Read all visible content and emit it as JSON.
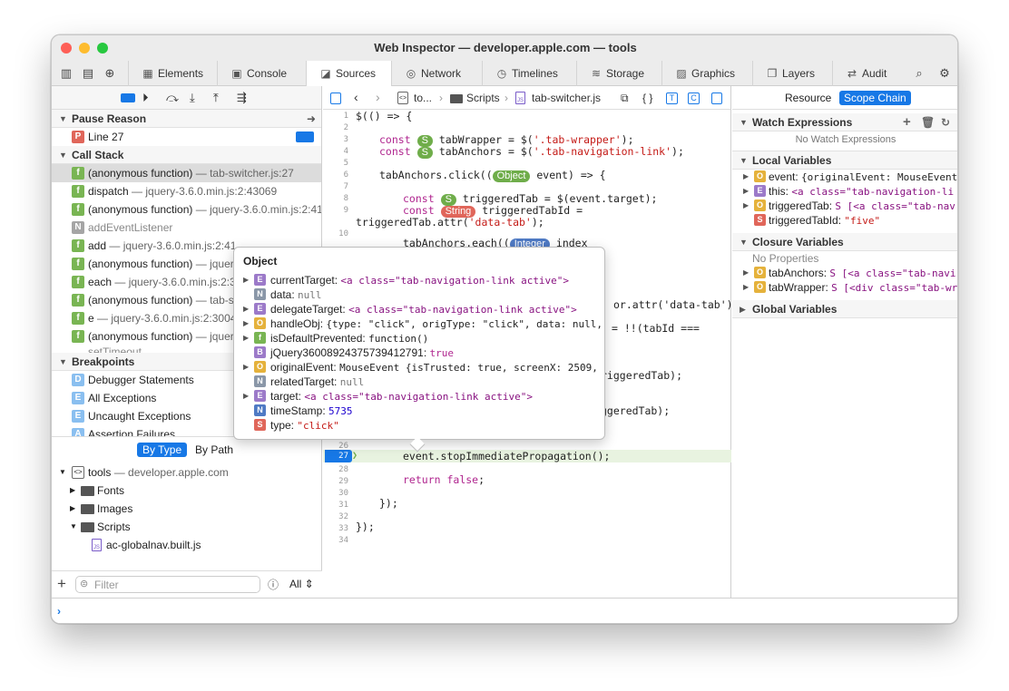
{
  "window": {
    "title": "Web Inspector — developer.apple.com — tools"
  },
  "tabs": [
    {
      "label": "Elements",
      "icon": "elements-icon"
    },
    {
      "label": "Console",
      "icon": "console-icon"
    },
    {
      "label": "Sources",
      "icon": "sources-icon"
    },
    {
      "label": "Network",
      "icon": "network-icon"
    },
    {
      "label": "Timelines",
      "icon": "timelines-icon"
    },
    {
      "label": "Storage",
      "icon": "storage-icon"
    },
    {
      "label": "Graphics",
      "icon": "graphics-icon"
    },
    {
      "label": "Layers",
      "icon": "layers-icon"
    },
    {
      "label": "Audit",
      "icon": "audit-icon"
    }
  ],
  "left": {
    "pause_reason_header": "Pause Reason",
    "pause_line": "Line 27",
    "call_stack_header": "Call Stack",
    "call_stack": [
      {
        "name": "(anonymous function)",
        "loc": "tab-switcher.js:27"
      },
      {
        "name": "dispatch",
        "loc": "jquery-3.6.0.min.js:2:43069"
      },
      {
        "name": "(anonymous function)",
        "loc": "jquery-3.6.0.min.js:2:41"
      },
      {
        "name": "addEventListener",
        "loc": ""
      },
      {
        "name": "add",
        "loc": "jquery-3.6.0.min.js:2:41"
      },
      {
        "name": "(anonymous function)",
        "loc": "jquery"
      },
      {
        "name": "each",
        "loc": "jquery-3.6.0.min.js:2:3"
      },
      {
        "name": "(anonymous function)",
        "loc": "tab-s"
      },
      {
        "name": "e",
        "loc": "jquery-3.6.0.min.js:2:3004"
      },
      {
        "name": "(anonymous function)",
        "loc": "jquery"
      },
      {
        "name": "setTimeout",
        "loc": ""
      }
    ],
    "breakpoints_header": "Breakpoints",
    "breakpoints": [
      "Debugger Statements",
      "All Exceptions",
      "Uncaught Exceptions",
      "Assertion Failures"
    ],
    "by_type": "By Type",
    "by_path": "By Path",
    "tree": [
      {
        "label": "tools",
        "sub": "developer.apple.com"
      },
      {
        "label": "Fonts"
      },
      {
        "label": "Images"
      },
      {
        "label": "Scripts"
      },
      {
        "label": "ac-globalnav.built.js"
      }
    ],
    "filter_placeholder": "Filter",
    "filter_scope": "All"
  },
  "center": {
    "breadcrumb": [
      "to...",
      "Scripts",
      "tab-switcher.js"
    ],
    "line_numbers": [
      "1",
      "2",
      "3",
      "4",
      "5",
      "6",
      "7",
      "8",
      "9",
      "10",
      "26",
      "27",
      "28",
      "29",
      "30",
      "31",
      "32",
      "33",
      "34"
    ],
    "code": {
      "l1": "$(() => {",
      "l3a": "const",
      "l3b": "tabWrapper = $(",
      "l3c": "'.tab-wrapper'",
      "l3d": ");",
      "l4a": "const",
      "l4b": "tabAnchors = $(",
      "l4c": "'.tab-navigation-link'",
      "l4d": ");",
      "l6a": "tabAnchors.click((",
      "l6b": "event) => {",
      "l8a": "const",
      "l8b": "triggeredTab = $(event.target);",
      "l9a": "const",
      "l9b": "triggeredTabId =",
      "l9c": "triggeredTab.attr(",
      "l9d": "'data-tab'",
      "l9e": ");",
      "l11": "tabAnchors.each((",
      "l11b": "index",
      "l12": "or.attr('data-tab');",
      "l13": "= !!(tabId ===",
      "l15": "riggeredTab);",
      "l17": "ggeredTab);",
      "l27": "event.stopImmediatePropagation();",
      "l29a": "return",
      "l29b": "false",
      "l29c": ";",
      "l31": "});",
      "l33": "});"
    },
    "badges": {
      "s": "S",
      "object": "Object",
      "string": "String",
      "integer": "Integer"
    }
  },
  "popover": {
    "title": "Object",
    "rows": [
      {
        "icon": "E",
        "name": "currentTarget:",
        "value": "<a class=\"tab-navigation-link active\">"
      },
      {
        "icon": "N",
        "name": "data:",
        "value": "null"
      },
      {
        "icon": "E",
        "name": "delegateTarget:",
        "value": "<a class=\"tab-navigation-link active\">"
      },
      {
        "icon": "O",
        "name": "handleObj:",
        "value": "{type: \"click\", origType: \"click\", data: null,"
      },
      {
        "icon": "f",
        "name": "isDefaultPrevented:",
        "value": "function()"
      },
      {
        "icon": "B",
        "name": "jQuery36008924375739412791:",
        "value": "true"
      },
      {
        "icon": "O",
        "name": "originalEvent:",
        "value": "MouseEvent {isTrusted: true, screenX: 2509,"
      },
      {
        "icon": "N",
        "name": "relatedTarget:",
        "value": "null"
      },
      {
        "icon": "E",
        "name": "target:",
        "value": "<a class=\"tab-navigation-link active\">"
      },
      {
        "icon": "N",
        "name": "timeStamp:",
        "value": "5735"
      },
      {
        "icon": "S",
        "name": "type:",
        "value": "\"click\""
      }
    ]
  },
  "right": {
    "resource_tab": "Resource",
    "scope_tab": "Scope Chain",
    "watch_header": "Watch Expressions",
    "no_watch": "No Watch Expressions",
    "local_header": "Local Variables",
    "locals": [
      {
        "icon": "O",
        "name": "event:",
        "value": "{originalEvent: MouseEvent"
      },
      {
        "icon": "E",
        "name": "this:",
        "value": "<a class=\"tab-navigation-li"
      },
      {
        "icon": "O",
        "name": "triggeredTab:",
        "value": "S [<a class=\"tab-nav"
      },
      {
        "icon": "S",
        "name": "triggeredTabId:",
        "value": "\"five\""
      }
    ],
    "closure_header": "Closure Variables",
    "no_properties": "No Properties",
    "closures": [
      {
        "icon": "O",
        "name": "tabAnchors:",
        "value": "S [<a class=\"tab-navi"
      },
      {
        "icon": "O",
        "name": "tabWrapper:",
        "value": "S [<div class=\"tab-wr"
      }
    ],
    "global_header": "Global Variables"
  },
  "colors": {
    "accent": "#1778e6",
    "paused_line_bg": "#e8f3e0"
  }
}
